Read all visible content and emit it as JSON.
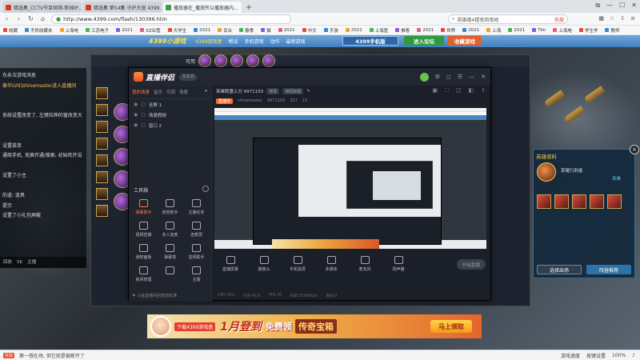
{
  "browser": {
    "tabs": [
      {
        "label": "精选集_CCTV节目官网-新闻IP...",
        "color": "#d23b2a"
      },
      {
        "label": "精选集 第54集 守护大宠 4399...",
        "color": "#d23b2a"
      },
      {
        "label": "播放器在_播放所以播放器内...",
        "color": "#3a9b4a"
      }
    ],
    "new_tab": "+",
    "window_controls": [
      "⧉",
      "—",
      "☐",
      "✕"
    ],
    "url": "http://www.4399.com/flash/130396.htm",
    "search_placeholder": "英雄缘4楼南岗南地",
    "search_hot": "热搜",
    "bookmarks": [
      "收藏",
      "手机收藏夹",
      "上海电",
      "江苏电子",
      "2021",
      "XZ业管",
      "大学生",
      "2021",
      "百合",
      "春季",
      "猫",
      "2021",
      "中文",
      "手游",
      "2021",
      "上海医",
      "推客",
      "2021",
      "世界",
      "2021",
      "上海",
      "2021",
      "Tim",
      "上海电",
      "学生学",
      "教师"
    ]
  },
  "site": {
    "logo": "4399小游戏",
    "nav": [
      {
        "label": "4399游戏盒",
        "hot": true
      },
      {
        "label": "帮派",
        "hot": false
      },
      {
        "label": "手机游戏",
        "hot": false
      },
      {
        "label": "动作",
        "hot": false
      },
      {
        "label": "最新游戏",
        "hot": false
      }
    ],
    "btn_phone": "4399手机版",
    "btn_forum": "进入论坛",
    "btn_fav": "收藏游戏"
  },
  "chat": {
    "lines": [
      {
        "text": "东永次游戏消息",
        "hl": false
      },
      {
        "text": "泰华LV9]shinemaster进入直播间",
        "hl": true
      },
      {
        "text": "",
        "hl": false
      },
      {
        "text": "",
        "hl": false
      },
      {
        "text": "系统设置改变了, 左键拉伸的窗改变大",
        "hl": false
      },
      {
        "text": "",
        "hl": false
      },
      {
        "text": "",
        "hl": false
      },
      {
        "text": "设置菜单",
        "hl": false
      },
      {
        "text": "通商手机, 竞换开通/搜索, 初始阵开设",
        "hl": false
      },
      {
        "text": "",
        "hl": false
      },
      {
        "text": "设置了小主",
        "hl": false
      },
      {
        "text": "",
        "hl": false
      },
      {
        "text": "的道: 道具",
        "hl": false
      },
      {
        "text": "提示",
        "hl": false
      },
      {
        "text": "设置了小礼包屏蔽",
        "hl": false
      }
    ],
    "footer": [
      "回放",
      "5K",
      "主播"
    ]
  },
  "game": {
    "top_title": "可用",
    "panel_title": "英雄资料",
    "panel_name": "荣耀行刺者",
    "panel_tab": "英雄",
    "btn_left": "选择出场",
    "btn_right": "阵容推荐"
  },
  "stream": {
    "logo": "直播伴侣",
    "version": "3.0.0",
    "header_controls": [
      "⚙",
      "◻",
      "☰",
      "—",
      "✕"
    ],
    "side_tabs": [
      "我的场景",
      "音乐",
      "可调",
      "场景"
    ],
    "scenes": [
      "全屏 1",
      "场景假帧",
      "窗口 2"
    ],
    "toolbox_title": "工具箱",
    "tools": [
      {
        "label": "弹幕助手",
        "on": true
      },
      {
        "label": "房管助手",
        "on": false
      },
      {
        "label": "主播任务",
        "on": false
      },
      {
        "label": "视频直播",
        "on": false
      },
      {
        "label": "多人连麦",
        "on": false
      },
      {
        "label": "连麦屏",
        "on": false
      },
      {
        "label": "通知面板",
        "on": false
      },
      {
        "label": "弹幕墙",
        "on": false
      },
      {
        "label": "音频助手",
        "on": false
      },
      {
        "label": "房间管理",
        "on": false
      },
      {
        "label": "",
        "on": false
      },
      {
        "label": "主题",
        "on": false
      }
    ],
    "side_footer": "⚑ 斗鱼直播间回放前标准",
    "room_title": "英雄联盟上分 9971150",
    "room_pills": [
      "修改",
      "简短标题"
    ],
    "room_sub": [
      "直播中",
      "shinemaster",
      "9971150",
      "327",
      "15"
    ],
    "room_tools": [
      "▣",
      "⛶",
      "◫",
      "◧",
      "⇪"
    ],
    "preview_banner": "下载4399游戏盒 1月登到 免费领 传奇宝箱",
    "actions": [
      "直播屏幕",
      "摄像头",
      "手机投屏",
      "多媒体",
      "麦克风",
      "扬声器"
    ],
    "start_live": "开始直播",
    "status": [
      "CPU:39%",
      "内存:41%",
      "FPS:30",
      "码率:2500kbps",
      "丢帧:0"
    ]
  },
  "ad": {
    "tag": "下载4399游戏盒",
    "big": "1月登到",
    "free": "免费领",
    "box": "传奇宝箱",
    "cta": "马上领取"
  },
  "statusbar": {
    "news_tag": "今日",
    "news": "第一想在场, 但它就是被断开了",
    "right": [
      "游戏速度",
      "按键设置",
      "100%",
      "♪"
    ]
  }
}
